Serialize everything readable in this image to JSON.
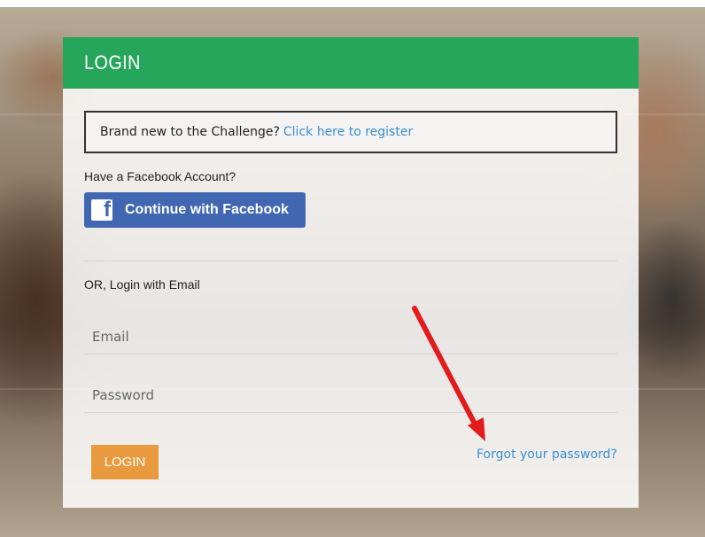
{
  "login": {
    "title": "LOGIN",
    "header_color": "#26a65b",
    "register_notice": {
      "text": "Brand new to the Challenge?",
      "link_label": "Click here to register"
    },
    "facebook": {
      "question": "Have a Facebook Account?",
      "button_label": "Continue with Facebook",
      "icon": "facebook-icon",
      "color": "#4267b2"
    },
    "email_login": {
      "label": "OR, Login with Email",
      "email_placeholder": "Email",
      "password_placeholder": "Password",
      "submit_label": "LOGIN",
      "submit_color": "#ea9a3e",
      "forgot_label": "Forgot your password?"
    }
  },
  "annotation": {
    "icon": "red-arrow",
    "color": "#e31b1b"
  }
}
